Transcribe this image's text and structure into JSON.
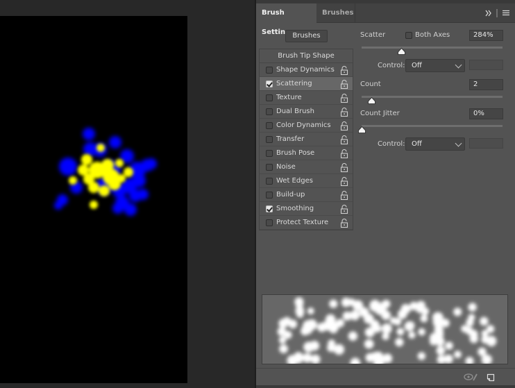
{
  "panel": {
    "tabs": [
      {
        "label": "Brush Settings",
        "active": true
      },
      {
        "label": "Brushes",
        "active": false
      }
    ],
    "controls": {
      "collapse_icon": "double-chevron-right-icon",
      "menu_icon": "hamburger-menu-icon"
    },
    "brushes_button_label": "Brushes"
  },
  "brush_list": {
    "header": "Brush Tip Shape",
    "items": [
      {
        "label": "Shape Dynamics",
        "checked": false,
        "selected": false
      },
      {
        "label": "Scattering",
        "checked": true,
        "selected": true
      },
      {
        "label": "Texture",
        "checked": false,
        "selected": false
      },
      {
        "label": "Dual Brush",
        "checked": false,
        "selected": false
      },
      {
        "label": "Color Dynamics",
        "checked": false,
        "selected": false
      },
      {
        "label": "Transfer",
        "checked": false,
        "selected": false
      },
      {
        "label": "Brush Pose",
        "checked": false,
        "selected": false
      },
      {
        "label": "Noise",
        "checked": false,
        "selected": false
      },
      {
        "label": "Wet Edges",
        "checked": false,
        "selected": false
      },
      {
        "label": "Build-up",
        "checked": false,
        "selected": false
      },
      {
        "label": "Smoothing",
        "checked": true,
        "selected": false
      },
      {
        "label": "Protect Texture",
        "checked": false,
        "selected": false
      }
    ],
    "lock_icon": "unlocked-padlock-icon"
  },
  "scattering": {
    "scatter": {
      "label": "Scatter",
      "value": "284%",
      "slider_fraction": 0.284
    },
    "both_axes": {
      "label": "Both Axes",
      "checked": false
    },
    "control1": {
      "label": "Control:",
      "value": "Off",
      "extra_field": ""
    },
    "count": {
      "label": "Count",
      "value": "2",
      "slider_fraction": 0.07
    },
    "count_jitter": {
      "label": "Count Jitter",
      "value": "0%",
      "slider_fraction": 0.0
    },
    "control2": {
      "label": "Control:",
      "value": "Off",
      "extra_field": ""
    }
  },
  "footer": {
    "toggle_preview_icon": "eye-brush-icon",
    "new_preset_icon": "new-brush-preset-icon"
  },
  "colors": {
    "canvas_bg": "#000000",
    "stroke_primary": "#ffff00",
    "stroke_secondary": "#0000ff",
    "panel_bg": "#535353",
    "preview_bg": "#676767"
  }
}
